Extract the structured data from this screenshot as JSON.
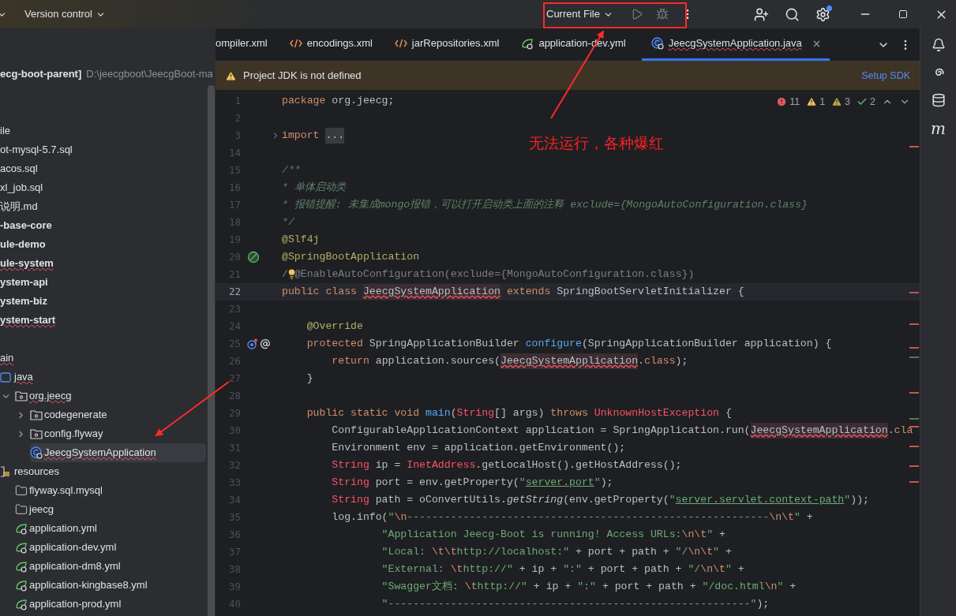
{
  "top_bar": {
    "project_menu": "Version control",
    "run_config": "Current File"
  },
  "project_tree": {
    "root": {
      "name": "ecg-boot-parent]",
      "path": "D:\\jeecgboot\\JeecgBoot-ma"
    },
    "items": [
      {
        "name": "ile",
        "bold": false,
        "error": false,
        "selected": false
      },
      {
        "name": "ot-mysql-5.7.sql",
        "bold": false,
        "error": false,
        "selected": false
      },
      {
        "name": "acos.sql",
        "bold": false,
        "error": false,
        "selected": false
      },
      {
        "name": "xl_job.sql",
        "bold": false,
        "error": false,
        "selected": false
      },
      {
        "name": "说明.md",
        "bold": false,
        "error": false,
        "selected": false
      },
      {
        "name": "-base-core",
        "bold": true,
        "error": false,
        "selected": false
      },
      {
        "name": "ule-demo",
        "bold": true,
        "error": false,
        "selected": false
      },
      {
        "name": "ule-system",
        "bold": true,
        "error": true,
        "selected": false
      },
      {
        "name": "ystem-api",
        "bold": true,
        "error": false,
        "selected": false
      },
      {
        "name": "ystem-biz",
        "bold": true,
        "error": false,
        "selected": false
      },
      {
        "name": "ystem-start",
        "bold": true,
        "error": true,
        "selected": false
      }
    ],
    "source_tree": [
      {
        "name": "ain",
        "error": true,
        "selected": false,
        "children": [
          {
            "name": "java",
            "kind": "source-root",
            "error": true,
            "selected": false,
            "children": [
              {
                "name": "org.jeecg",
                "kind": "package",
                "expanded": true,
                "error": true,
                "selected": false,
                "children": [
                  {
                    "name": "codegenerate",
                    "kind": "package",
                    "expanded": false,
                    "error": false,
                    "selected": false
                  },
                  {
                    "name": "config.flyway",
                    "kind": "package",
                    "expanded": false,
                    "error": false,
                    "selected": false
                  },
                  {
                    "name": "JeecgSystemApplication",
                    "kind": "class",
                    "error": true,
                    "selected": true
                  }
                ]
              }
            ]
          },
          {
            "name": "resources",
            "kind": "resource-root",
            "error": false,
            "selected": false,
            "children": [
              {
                "name": "flyway.sql.mysql",
                "kind": "folder",
                "error": false,
                "selected": false
              },
              {
                "name": "jeecg",
                "kind": "folder",
                "error": false,
                "selected": false
              },
              {
                "name": "application.yml",
                "kind": "yml",
                "error": false,
                "selected": false
              },
              {
                "name": "application-dev.yml",
                "kind": "yml",
                "error": false,
                "selected": false
              },
              {
                "name": "application-dm8.yml",
                "kind": "yml",
                "error": false,
                "selected": false
              },
              {
                "name": "application-kingbase8.yml",
                "kind": "yml",
                "error": false,
                "selected": false
              },
              {
                "name": "application-prod.yml",
                "kind": "yml",
                "error": false,
                "selected": false
              }
            ]
          }
        ]
      }
    ]
  },
  "tabs": [
    {
      "label": "ompiler.xml",
      "kind": "none",
      "selected": false
    },
    {
      "label": "encodings.xml",
      "kind": "xml",
      "selected": false
    },
    {
      "label": "jarRepositories.xml",
      "kind": "xml",
      "selected": false
    },
    {
      "label": "application-dev.yml",
      "kind": "yml",
      "selected": false
    },
    {
      "label": "JeecgSystemApplication.java",
      "kind": "java",
      "selected": true
    }
  ],
  "banner": {
    "message": "Project JDK is not defined",
    "action": "Setup SDK"
  },
  "inspections": [
    {
      "kind": "error",
      "count": "11"
    },
    {
      "kind": "warning",
      "count": "1"
    },
    {
      "kind": "weak",
      "count": "3"
    },
    {
      "kind": "typo",
      "count": "2"
    }
  ],
  "code_lines": [
    {
      "n": "1",
      "current": false,
      "tokens": [
        {
          "text": "package ",
          "kind": "kw"
        },
        {
          "text": "org.jeecg;",
          "kind": "plain"
        }
      ]
    },
    {
      "n": "2",
      "current": false
    },
    {
      "n": "3",
      "current": false,
      "fold": true,
      "tokens": [
        {
          "text": "import ",
          "kind": "kw"
        },
        {
          "text": "...",
          "kind": "folded"
        }
      ]
    },
    {
      "n": "14",
      "current": false
    },
    {
      "n": "15",
      "current": false,
      "tokens": [
        {
          "text": "/**",
          "kind": "doc"
        }
      ]
    },
    {
      "n": "16",
      "current": false,
      "tokens": [
        {
          "text": "* 单体启动类",
          "kind": "doc"
        }
      ]
    },
    {
      "n": "17",
      "current": false,
      "tokens": [
        {
          "text": "* 报错提醒: 未集成mongo报错，可以打开启动类上面的注释 exclude={MongoAutoConfiguration.class}",
          "kind": "doc"
        }
      ]
    },
    {
      "n": "18",
      "current": false,
      "tokens": [
        {
          "text": "*/",
          "kind": "doc"
        }
      ]
    },
    {
      "n": "19",
      "current": false,
      "tokens": [
        {
          "text": "@Slf4j",
          "kind": "ann"
        }
      ]
    },
    {
      "n": "20",
      "current": false,
      "gutter": {
        "kind": "bean"
      },
      "tokens": [
        {
          "text": "@SpringBootApplication",
          "kind": "ann"
        }
      ]
    },
    {
      "n": "21",
      "current": false,
      "hint": true,
      "tokens": [
        {
          "text": "/",
          "kind": "comment"
        },
        {
          "text": "@EnableAutoConfiguration(exclude={MongoAutoConfiguration.class})",
          "kind": "comment"
        }
      ]
    },
    {
      "n": "22",
      "current": true,
      "tokens": [
        {
          "text": "public class ",
          "kind": "kw"
        },
        {
          "text": "JeecgSystemApplication",
          "kind": "ref"
        },
        {
          "text": " extends ",
          "kind": "kw"
        },
        {
          "text": "SpringBootServletInitializer {",
          "kind": "plain"
        }
      ]
    },
    {
      "n": "23",
      "current": false
    },
    {
      "n": "24",
      "current": false,
      "tokens": [
        {
          "text": "    @Override",
          "kind": "ann"
        }
      ]
    },
    {
      "n": "25",
      "current": false,
      "gutter": {
        "kind": "override"
      },
      "tokens": [
        {
          "text": "    protected ",
          "kind": "kw"
        },
        {
          "text": "SpringApplicationBuilder ",
          "kind": "plain"
        },
        {
          "text": "configure",
          "kind": "fn"
        },
        {
          "text": "(SpringApplicationBuilder application) {",
          "kind": "plain"
        }
      ]
    },
    {
      "n": "26",
      "current": false,
      "tokens": [
        {
          "text": "        return ",
          "kind": "kw"
        },
        {
          "text": "application.sources(",
          "kind": "plain"
        },
        {
          "text": "JeecgSystemApplication",
          "kind": "ref"
        },
        {
          "text": ".",
          "kind": "plain"
        },
        {
          "text": "class",
          "kind": "kw"
        },
        {
          "text": ");",
          "kind": "plain"
        }
      ]
    },
    {
      "n": "27",
      "current": false,
      "tokens": [
        {
          "text": "    }",
          "kind": "plain"
        }
      ]
    },
    {
      "n": "28",
      "current": false
    },
    {
      "n": "29",
      "current": false,
      "tokens": [
        {
          "text": "    public static void ",
          "kind": "kw"
        },
        {
          "text": "main",
          "kind": "fn"
        },
        {
          "text": "(",
          "kind": "plain"
        },
        {
          "text": "String",
          "kind": "err"
        },
        {
          "text": "[] args) ",
          "kind": "plain"
        },
        {
          "text": "throws ",
          "kind": "kw"
        },
        {
          "text": "UnknownHostException",
          "kind": "err"
        },
        {
          "text": " {",
          "kind": "plain"
        }
      ]
    },
    {
      "n": "30",
      "current": false,
      "tokens": [
        {
          "text": "        ConfigurableApplicationContext application = SpringApplication.run(",
          "kind": "plain"
        },
        {
          "text": "JeecgSystemApplication",
          "kind": "ref"
        },
        {
          "text": ".",
          "kind": "plain"
        },
        {
          "text": "cla",
          "kind": "kw"
        }
      ]
    },
    {
      "n": "31",
      "current": false,
      "tokens": [
        {
          "text": "        Environment env = application.getEnvironment();",
          "kind": "plain"
        }
      ]
    },
    {
      "n": "32",
      "current": false,
      "tokens": [
        {
          "text": "        String",
          "kind": "err"
        },
        {
          "text": " ip = ",
          "kind": "plain"
        },
        {
          "text": "InetAddress",
          "kind": "err"
        },
        {
          "text": ".getLocalHost().getHostAddress();",
          "kind": "plain"
        }
      ]
    },
    {
      "n": "33",
      "current": false,
      "tokens": [
        {
          "text": "        String",
          "kind": "err"
        },
        {
          "text": " port = env.getProperty(",
          "kind": "plain"
        },
        {
          "text": "\"",
          "kind": "str"
        },
        {
          "text": "server.port",
          "kind": "strlink"
        },
        {
          "text": "\"",
          "kind": "str"
        },
        {
          "text": ");",
          "kind": "plain"
        }
      ]
    },
    {
      "n": "34",
      "current": false,
      "tokens": [
        {
          "text": "        String",
          "kind": "err"
        },
        {
          "text": " path = oConvertUtils.",
          "kind": "plain"
        },
        {
          "text": "getString",
          "kind": "static"
        },
        {
          "text": "(env.getProperty(",
          "kind": "plain"
        },
        {
          "text": "\"",
          "kind": "str"
        },
        {
          "text": "server.servlet.context-path",
          "kind": "strlink"
        },
        {
          "text": "\"",
          "kind": "str"
        },
        {
          "text": "));",
          "kind": "plain"
        }
      ]
    },
    {
      "n": "35",
      "current": false,
      "tokens": [
        {
          "text": "        log.info(",
          "kind": "plain"
        },
        {
          "text": "\"",
          "kind": "str"
        },
        {
          "text": "\\n",
          "kind": "esc"
        },
        {
          "text": "----------------------------------------------------------",
          "kind": "str"
        },
        {
          "text": "\\n\\t",
          "kind": "esc"
        },
        {
          "text": "\"",
          "kind": "str"
        },
        {
          "text": " +",
          "kind": "plain"
        }
      ]
    },
    {
      "n": "36",
      "current": false,
      "tokens": [
        {
          "text": "                \"Application Jeecg-Boot is running! Access URLs:",
          "kind": "str"
        },
        {
          "text": "\\n\\t",
          "kind": "esc"
        },
        {
          "text": "\"",
          "kind": "str"
        },
        {
          "text": " +",
          "kind": "plain"
        }
      ]
    },
    {
      "n": "37",
      "current": false,
      "tokens": [
        {
          "text": "                \"Local: ",
          "kind": "str"
        },
        {
          "text": "\\t\\t",
          "kind": "esc"
        },
        {
          "text": "http://localhost:\"",
          "kind": "str"
        },
        {
          "text": " + port + path + ",
          "kind": "plain"
        },
        {
          "text": "\"/",
          "kind": "str"
        },
        {
          "text": "\\n\\t",
          "kind": "esc"
        },
        {
          "text": "\"",
          "kind": "str"
        },
        {
          "text": " +",
          "kind": "plain"
        }
      ]
    },
    {
      "n": "38",
      "current": false,
      "tokens": [
        {
          "text": "                \"External: ",
          "kind": "str"
        },
        {
          "text": "\\t",
          "kind": "esc"
        },
        {
          "text": "http://\"",
          "kind": "str"
        },
        {
          "text": " + ip + ",
          "kind": "plain"
        },
        {
          "text": "\":\"",
          "kind": "str"
        },
        {
          "text": " + port + path + ",
          "kind": "plain"
        },
        {
          "text": "\"/",
          "kind": "str"
        },
        {
          "text": "\\n\\t",
          "kind": "esc"
        },
        {
          "text": "\"",
          "kind": "str"
        },
        {
          "text": " +",
          "kind": "plain"
        }
      ]
    },
    {
      "n": "39",
      "current": false,
      "tokens": [
        {
          "text": "                \"Swagger文档: ",
          "kind": "str"
        },
        {
          "text": "\\t",
          "kind": "esc"
        },
        {
          "text": "http://\"",
          "kind": "str"
        },
        {
          "text": " + ip + ",
          "kind": "plain"
        },
        {
          "text": "\":\"",
          "kind": "str"
        },
        {
          "text": " + port + path + ",
          "kind": "plain"
        },
        {
          "text": "\"/doc.html",
          "kind": "str"
        },
        {
          "text": "\\n",
          "kind": "esc"
        },
        {
          "text": "\"",
          "kind": "str"
        },
        {
          "text": " +",
          "kind": "plain"
        }
      ]
    },
    {
      "n": "40",
      "current": false,
      "tokens": [
        {
          "text": "                \"----------------------------------------------------------\"",
          "kind": "str"
        },
        {
          "text": ");",
          "kind": "plain"
        }
      ]
    }
  ],
  "tool_strip": {
    "maven_label": "m"
  },
  "annotation": {
    "text": "无法运行，各种爆红"
  }
}
